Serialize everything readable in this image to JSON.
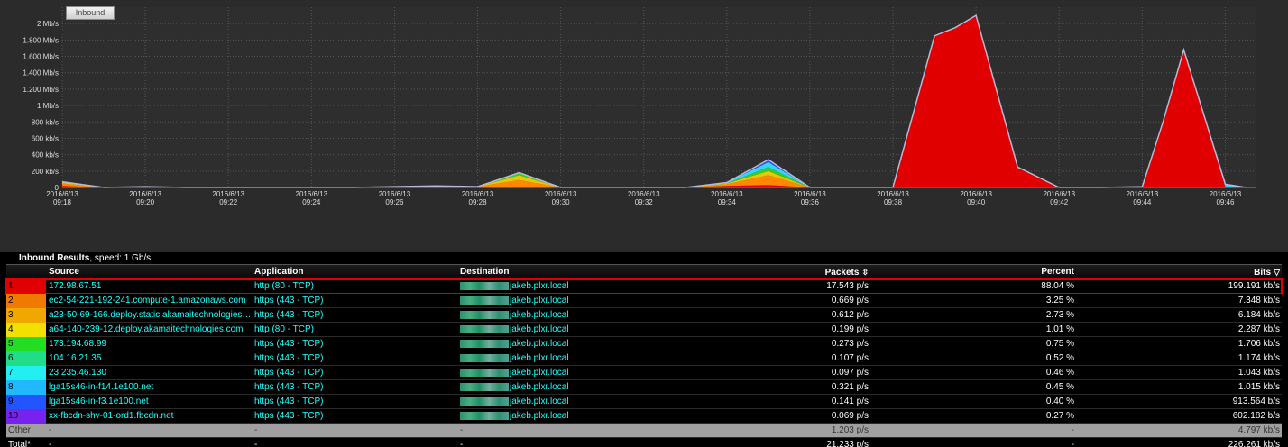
{
  "chart": {
    "legend_button": "Inbound",
    "y_ticks": [
      "2 Mb/s",
      "1.800 Mb/s",
      "1.600 Mb/s",
      "1.400 Mb/s",
      "1.200 Mb/s",
      "1 Mb/s",
      "800 kb/s",
      "600 kb/s",
      "400 kb/s",
      "200 kb/s",
      "0"
    ],
    "x_ticks": [
      {
        "d": "2016/6/13",
        "t": "09:18"
      },
      {
        "d": "2016/6/13",
        "t": "09:20"
      },
      {
        "d": "2016/6/13",
        "t": "09:22"
      },
      {
        "d": "2016/6/13",
        "t": "09:24"
      },
      {
        "d": "2016/6/13",
        "t": "09:26"
      },
      {
        "d": "2016/6/13",
        "t": "09:28"
      },
      {
        "d": "2016/6/13",
        "t": "09:30"
      },
      {
        "d": "2016/6/13",
        "t": "09:32"
      },
      {
        "d": "2016/6/13",
        "t": "09:34"
      },
      {
        "d": "2016/6/13",
        "t": "09:36"
      },
      {
        "d": "2016/6/13",
        "t": "09:38"
      },
      {
        "d": "2016/6/13",
        "t": "09:40"
      },
      {
        "d": "2016/6/13",
        "t": "09:42"
      },
      {
        "d": "2016/6/13",
        "t": "09:44"
      },
      {
        "d": "2016/6/13",
        "t": "09:46"
      }
    ]
  },
  "chart_data": {
    "type": "area",
    "ylim": [
      0,
      2.2
    ],
    "y_unit": "Mb/s",
    "x_minutes": [
      18,
      19,
      20,
      21,
      22,
      23,
      24,
      25,
      26,
      27,
      28,
      29,
      30,
      31,
      32,
      33,
      34,
      35,
      36,
      37,
      38,
      39,
      39.5,
      40,
      41,
      42,
      43,
      44,
      44.5,
      45,
      46,
      46.5
    ],
    "series": [
      {
        "color": "#e00000",
        "values": [
          0.02,
          0,
          0.01,
          0,
          0,
          0,
          0,
          0,
          0.01,
          0.02,
          0,
          0.01,
          0,
          0,
          0,
          0,
          0.02,
          0.03,
          0,
          0,
          0,
          1.85,
          1.95,
          2.1,
          0.25,
          0,
          0,
          0.01,
          0.8,
          1.68,
          0.01,
          0
        ]
      },
      {
        "color": "#ff8800",
        "values": [
          0.03,
          0,
          0,
          0,
          0,
          0,
          0,
          0,
          0,
          0,
          0.01,
          0.08,
          0,
          0,
          0,
          0,
          0.02,
          0.12,
          0,
          0,
          0,
          0,
          0,
          0,
          0,
          0,
          0,
          0,
          0,
          0,
          0,
          0
        ]
      },
      {
        "color": "#e8c800",
        "values": [
          0.02,
          0,
          0,
          0,
          0,
          0,
          0,
          0,
          0,
          0,
          0,
          0.06,
          0,
          0,
          0,
          0,
          0.01,
          0.05,
          0,
          0,
          0,
          0,
          0,
          0,
          0,
          0,
          0,
          0,
          0,
          0,
          0,
          0
        ]
      },
      {
        "color": "#33cc33",
        "values": [
          0,
          0,
          0,
          0,
          0,
          0,
          0,
          0,
          0,
          0,
          0,
          0.03,
          0,
          0,
          0,
          0,
          0,
          0.05,
          0,
          0,
          0,
          0,
          0,
          0,
          0,
          0,
          0,
          0,
          0,
          0,
          0,
          0
        ]
      },
      {
        "color": "#33d6ff",
        "values": [
          0,
          0,
          0,
          0,
          0,
          0,
          0,
          0,
          0,
          0,
          0,
          0,
          0,
          0,
          0,
          0,
          0.01,
          0.06,
          0,
          0,
          0,
          0,
          0,
          0,
          0,
          0,
          0,
          0,
          0,
          0,
          0.02,
          0
        ]
      },
      {
        "color": "#3344ee",
        "values": [
          0,
          0,
          0,
          0,
          0,
          0,
          0,
          0,
          0,
          0,
          0,
          0,
          0,
          0,
          0,
          0,
          0,
          0.03,
          0,
          0,
          0,
          0,
          0,
          0,
          0,
          0,
          0,
          0,
          0,
          0,
          0.01,
          0
        ]
      }
    ]
  },
  "results": {
    "title_bold": "Inbound Results",
    "title_rest": ", speed: 1 Gb/s",
    "headers": {
      "source": "Source",
      "application": "Application",
      "destination": "Destination",
      "packets": "Packets",
      "percent": "Percent",
      "bits": "Bits"
    },
    "rows": [
      {
        "rank": "1",
        "color": "#e00000",
        "source": "172.98.67.51",
        "app": "http (80 - TCP)",
        "dest": "jakeb.plxr.local",
        "packets": "17.543 p/s",
        "percent": "88.04 %",
        "bits": "199.191 kb/s"
      },
      {
        "rank": "2",
        "color": "#ee7a00",
        "source": "ec2-54-221-192-241.compute-1.amazonaws.com",
        "app": "https (443 - TCP)",
        "dest": "jakeb.plxr.local",
        "packets": "0.669 p/s",
        "percent": "3.25 %",
        "bits": "7.348 kb/s"
      },
      {
        "rank": "3",
        "color": "#f0a800",
        "source": "a23-50-69-166.deploy.static.akamaitechnologies.com",
        "app": "https (443 - TCP)",
        "dest": "jakeb.plxr.local",
        "packets": "0.612 p/s",
        "percent": "2.73 %",
        "bits": "6.184 kb/s"
      },
      {
        "rank": "4",
        "color": "#f2e000",
        "source": "a64-140-239-12.deploy.akamaitechnologies.com",
        "app": "http (80 - TCP)",
        "dest": "jakeb.plxr.local",
        "packets": "0.199 p/s",
        "percent": "1.01 %",
        "bits": "2.287 kb/s"
      },
      {
        "rank": "5",
        "color": "#22dd22",
        "source": "173.194.68.99",
        "app": "https (443 - TCP)",
        "dest": "jakeb.plxr.local",
        "packets": "0.273 p/s",
        "percent": "0.75 %",
        "bits": "1.706 kb/s"
      },
      {
        "rank": "6",
        "color": "#22dd88",
        "source": "104.16.21.35",
        "app": "https (443 - TCP)",
        "dest": "jakeb.plxr.local",
        "packets": "0.107 p/s",
        "percent": "0.52 %",
        "bits": "1.174 kb/s"
      },
      {
        "rank": "7",
        "color": "#22f0f0",
        "source": "23.235.46.130",
        "app": "https (443 - TCP)",
        "dest": "jakeb.plxr.local",
        "packets": "0.097 p/s",
        "percent": "0.46 %",
        "bits": "1.043 kb/s"
      },
      {
        "rank": "8",
        "color": "#22b8ff",
        "source": "lga15s46-in-f14.1e100.net",
        "app": "https (443 - TCP)",
        "dest": "jakeb.plxr.local",
        "packets": "0.321 p/s",
        "percent": "0.45 %",
        "bits": "1.015 kb/s"
      },
      {
        "rank": "9",
        "color": "#2255ff",
        "source": "lga15s46-in-f3.1e100.net",
        "app": "https (443 - TCP)",
        "dest": "jakeb.plxr.local",
        "packets": "0.141 p/s",
        "percent": "0.40 %",
        "bits": "913.564 b/s"
      },
      {
        "rank": "10",
        "color": "#7722ee",
        "source": "xx-fbcdn-shv-01-ord1.fbcdn.net",
        "app": "https (443 - TCP)",
        "dest": "jakeb.plxr.local",
        "packets": "0.069 p/s",
        "percent": "0.27 %",
        "bits": "602.182 b/s"
      }
    ],
    "other": {
      "rank": "Other",
      "source": "-",
      "app": "-",
      "dest": "-",
      "packets": "1.203 p/s",
      "percent": "-",
      "bits": "4.797 kb/s"
    },
    "total": {
      "rank": "Total*",
      "source": "-",
      "app": "-",
      "dest": "-",
      "packets": "21.233 p/s",
      "percent": "-",
      "bits": "226.261 kb/s"
    }
  }
}
